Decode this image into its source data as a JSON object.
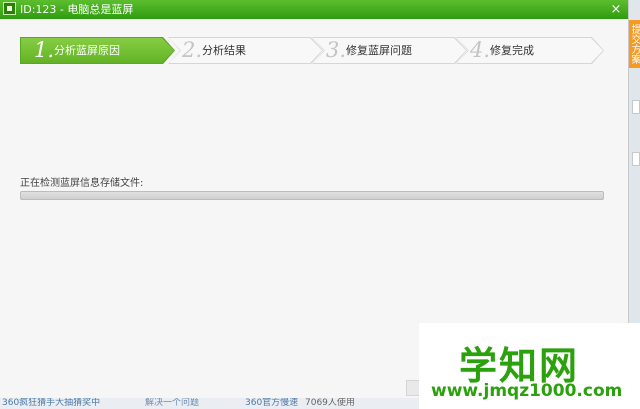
{
  "window": {
    "title": "ID:123 - 电脑总是蓝屏",
    "close_glyph": "×"
  },
  "steps": [
    {
      "num": "1.",
      "label": "分析蓝屏原因",
      "state": "active"
    },
    {
      "num": "2.",
      "label": "分析结果",
      "state": "pending"
    },
    {
      "num": "3.",
      "label": "修复蓝屏问题",
      "state": "pending"
    },
    {
      "num": "4.",
      "label": "修复完成",
      "state": "pending"
    }
  ],
  "status": {
    "label": "正在检测蓝屏信息存储文件:",
    "progress": 0
  },
  "side_panel": {
    "tab_label": "提交方案"
  },
  "background": {
    "item1": "360疯狂猜手大抽猜奖中",
    "item2": "解决一个问题",
    "item3": "360官方慢速",
    "item4": "7069人使用"
  },
  "watermark": {
    "title": "学知网",
    "url": "www.jmqz1000.com"
  },
  "colors": {
    "title_green": "#3aa91a",
    "step_active": "#73bd33",
    "side_tab_orange": "#f59a23",
    "watermark_green": "#2aa10d"
  }
}
